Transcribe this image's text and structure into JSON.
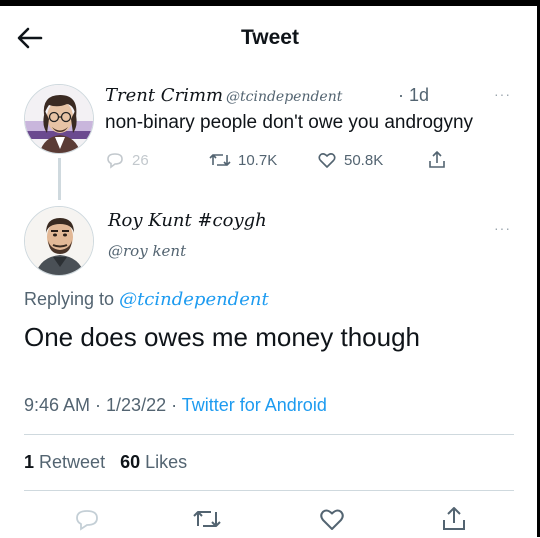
{
  "header": {
    "title": "Tweet"
  },
  "parent_tweet": {
    "name": "Trent Crimm",
    "handle": "@tcindependent",
    "time": "· 1d",
    "more": "···",
    "text": "non-binary people don't owe you androgyny",
    "replies": "26",
    "retweets": "10.7K",
    "likes": "50.8K"
  },
  "main_tweet": {
    "name": "Roy Kunt #coygh",
    "handle": "@roy kent",
    "more": "···",
    "replying_prefix": "Replying to",
    "replying_to": "@tcindependent",
    "text": "One does owes me money though",
    "timestamp": "9:46 AM · 1/23/22 · ",
    "source": "Twitter for Android",
    "retweet_count": "1",
    "retweet_label": "Retweet",
    "like_count": "60",
    "like_label": "Likes"
  },
  "colors": {
    "accent": "#1d9bf0",
    "secondary_text": "#536471",
    "divider": "#cfd9de"
  },
  "icons": [
    "back-arrow-icon",
    "reply-icon",
    "retweet-icon",
    "like-icon",
    "share-icon",
    "more-icon"
  ]
}
